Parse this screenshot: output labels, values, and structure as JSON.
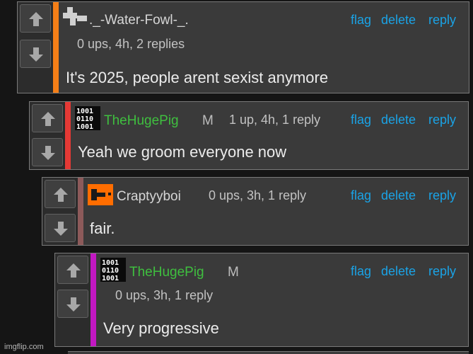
{
  "comments": [
    {
      "username": "._-Water-Fowl-_.",
      "moderator": "",
      "meta": "0 ups, 4h, 2 replies",
      "text": "It's 2025, people arent sexist anymore",
      "bar_color": "#f57f17",
      "avatar": "pixel-avatar-icon"
    },
    {
      "username": "TheHugePig",
      "moderator": "M",
      "meta": "1 up, 4h, 1 reply",
      "text": "Yeah we groom everyone now",
      "bar_color": "#e53935",
      "avatar": "binary-avatar-icon"
    },
    {
      "username": "Craptyyboi",
      "moderator": "",
      "meta": "0 ups, 3h, 1 reply",
      "text": "fair.",
      "bar_color": "#8d5a5a",
      "avatar": "orange-avatar-icon"
    },
    {
      "username": "TheHugePig",
      "moderator": "M",
      "meta": "0 ups, 3h, 1 reply",
      "text": "Very progressive",
      "bar_color": "#c218c2",
      "avatar": "binary-avatar-icon"
    }
  ],
  "actions": {
    "flag": "flag",
    "delete": "delete",
    "reply": "reply"
  },
  "binary_avatar": {
    "line1": "1001",
    "line2": "0110",
    "line3": "1001"
  },
  "watermark": "imgflip.com",
  "colors": {
    "link": "#1aa3e6",
    "username_green": "#3fbf3f",
    "background": "#151515"
  }
}
